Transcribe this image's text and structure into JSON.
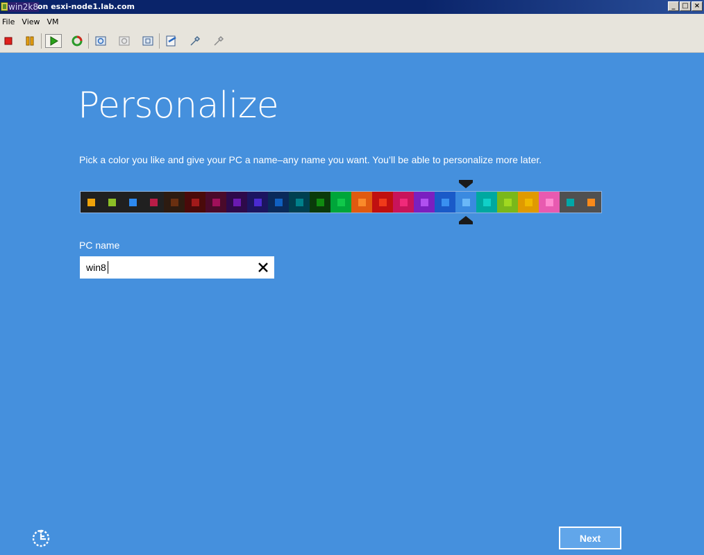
{
  "window": {
    "vm_name": "win2k8",
    "title_suffix": "on esxi-node1.lab.com",
    "controls": [
      "_",
      "□",
      "×"
    ]
  },
  "menu": {
    "items": [
      "File",
      "View",
      "VM"
    ]
  },
  "toolbar": {
    "buttons": [
      {
        "name": "power-off-icon",
        "color": "#e0201c"
      },
      {
        "name": "suspend-icon",
        "color": "#e8a010"
      },
      {
        "name": "power-on-icon",
        "color": "#2aa21a",
        "active": true
      },
      {
        "name": "reset-icon",
        "color": "#d0281c"
      },
      {
        "name": "snapshot-icon"
      },
      {
        "name": "revert-snapshot-icon"
      },
      {
        "name": "snapshot-manager-icon"
      },
      {
        "name": "edit-settings-icon"
      },
      {
        "name": "vm-tools-icon"
      },
      {
        "name": "console-options-icon"
      }
    ]
  },
  "page": {
    "heading": "Personalize",
    "description": "Pick a color you like and give your PC a name–any name you want. You’ll be able to personalize more later.",
    "pc_name_label": "PC name",
    "pc_name_value": "win8",
    "next_label": "Next"
  },
  "palette": {
    "selected_index": 18,
    "swatches": [
      {
        "bg": "#202020",
        "dot": "#f0a30a"
      },
      {
        "bg": "#202020",
        "dot": "#8cbf26"
      },
      {
        "bg": "#202020",
        "dot": "#2d89ef"
      },
      {
        "bg": "#202020",
        "dot": "#b91d47"
      },
      {
        "bg": "#2d1b10",
        "dot": "#6a2f10"
      },
      {
        "bg": "#4a0a0a",
        "dot": "#a21a1a"
      },
      {
        "bg": "#4a0a2a",
        "dot": "#a0105a"
      },
      {
        "bg": "#2e0a4a",
        "dot": "#6a1ab0"
      },
      {
        "bg": "#1c1560",
        "dot": "#4a2ad0"
      },
      {
        "bg": "#0a2a5a",
        "dot": "#1060c0"
      },
      {
        "bg": "#004050",
        "dot": "#00808a"
      },
      {
        "bg": "#0a3a0a",
        "dot": "#108a10"
      },
      {
        "bg": "#00a63a",
        "dot": "#10c84a"
      },
      {
        "bg": "#e05a10",
        "dot": "#fa8a2a"
      },
      {
        "bg": "#c01010",
        "dot": "#f03a1a"
      },
      {
        "bg": "#c8145a",
        "dot": "#f02a7a"
      },
      {
        "bg": "#7a20c0",
        "dot": "#b050f0"
      },
      {
        "bg": "#1a5ac8",
        "dot": "#3a90f0"
      },
      {
        "bg": "#3a8ae0",
        "dot": "#6ab8f8"
      },
      {
        "bg": "#00a8a0",
        "dot": "#10d0c8"
      },
      {
        "bg": "#7ab81a",
        "dot": "#a0d820"
      },
      {
        "bg": "#e09a00",
        "dot": "#f0b800"
      },
      {
        "bg": "#e85ab0",
        "dot": "#ff8ad0"
      },
      {
        "bg": "#505050",
        "dot": "#00a8a8"
      },
      {
        "bg": "#505050",
        "dot": "#fa8a1a"
      }
    ]
  }
}
